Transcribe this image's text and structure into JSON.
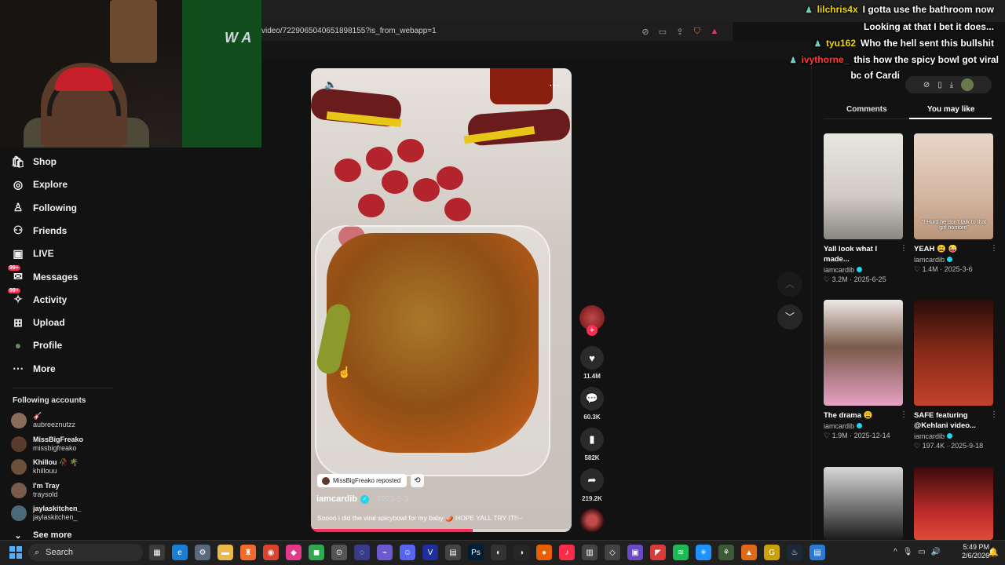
{
  "browser": {
    "url": "video/7229065040651898155?is_from_webapp=1"
  },
  "webcam": {
    "overlay_logo": "W A"
  },
  "sidebar": {
    "items": [
      {
        "label": "Shop",
        "icon": "shop-icon"
      },
      {
        "label": "Explore",
        "icon": "compass-icon"
      },
      {
        "label": "Following",
        "icon": "following-icon"
      },
      {
        "label": "Friends",
        "icon": "friends-icon"
      },
      {
        "label": "LIVE",
        "icon": "live-icon"
      },
      {
        "label": "Messages",
        "icon": "messages-icon",
        "badge": "99+"
      },
      {
        "label": "Activity",
        "icon": "activity-icon",
        "badge": "99+"
      },
      {
        "label": "Upload",
        "icon": "upload-icon"
      },
      {
        "label": "Profile",
        "icon": "profile-avatar"
      },
      {
        "label": "More",
        "icon": "more-icon"
      }
    ],
    "following_title": "Following accounts",
    "accounts": [
      {
        "name": "🎸",
        "handle": "aubreeznutzz"
      },
      {
        "name": "MissBigFreako",
        "handle": "missbigfreako"
      },
      {
        "name": "Khillou 🥀 🌴",
        "handle": "khillouu"
      },
      {
        "name": "I'm Tray",
        "handle": "traysold"
      },
      {
        "name": "jaylaskitchen_",
        "handle": "jaylaskitchen_"
      }
    ],
    "see_more": "See more"
  },
  "video": {
    "repost_label": "MissBigFreako reposted",
    "author": "iamcardib",
    "date": "2023-5-3",
    "caption": "Soooo i did the viral spicybowl for my baby 🌶️ HOPE YALL TRY IT!!--",
    "progress": 0.62
  },
  "actions": {
    "likes": "11.4M",
    "comments": "60.3K",
    "saves": "582K",
    "shares": "219.2K"
  },
  "panel": {
    "tabs": [
      "Comments",
      "You may like"
    ],
    "active_tab": "You may like",
    "cards": [
      {
        "title": "Yall look what I made...",
        "author": "iamcardib",
        "likes": "3.2M",
        "date": "2025-6-25"
      },
      {
        "title": "YEAH 😩 😜",
        "author": "iamcardib",
        "likes": "1.4M",
        "date": "2025-3-6",
        "thumb_text": "\"I Hurd he don't talk to that girl nomore\""
      },
      {
        "title": "The drama 😩",
        "author": "iamcardib",
        "likes": "1.9M",
        "date": "2025-12-14"
      },
      {
        "title": "SAFE featuring @Kehlani video...",
        "author": "iamcardib",
        "likes": "197.4K",
        "date": "2025-9-18"
      },
      {
        "title": "",
        "author": "",
        "likes": "",
        "date": ""
      },
      {
        "title": "",
        "author": "",
        "likes": "",
        "date": ""
      }
    ]
  },
  "chat": [
    {
      "user": "lilchris4x",
      "user_color": "#f0d500",
      "message": "I gotta use the bathroom now"
    },
    {
      "user": "",
      "user_color": "#ff3b3b",
      "message": "Looking at that I bet it does..."
    },
    {
      "user": "tyu162",
      "user_color": "#f0d500",
      "message": "Who the hell sent this bullshit"
    },
    {
      "user": "ivythorne_",
      "user_color": "#ff3b3b",
      "message": "this how the spicy bowl got viral"
    },
    {
      "user": "",
      "user_color": "#ffffff",
      "message": "bc of Cardi"
    }
  ],
  "taskbar": {
    "search_label": "Search",
    "time": "5:49 PM",
    "date": "2/6/2026"
  }
}
